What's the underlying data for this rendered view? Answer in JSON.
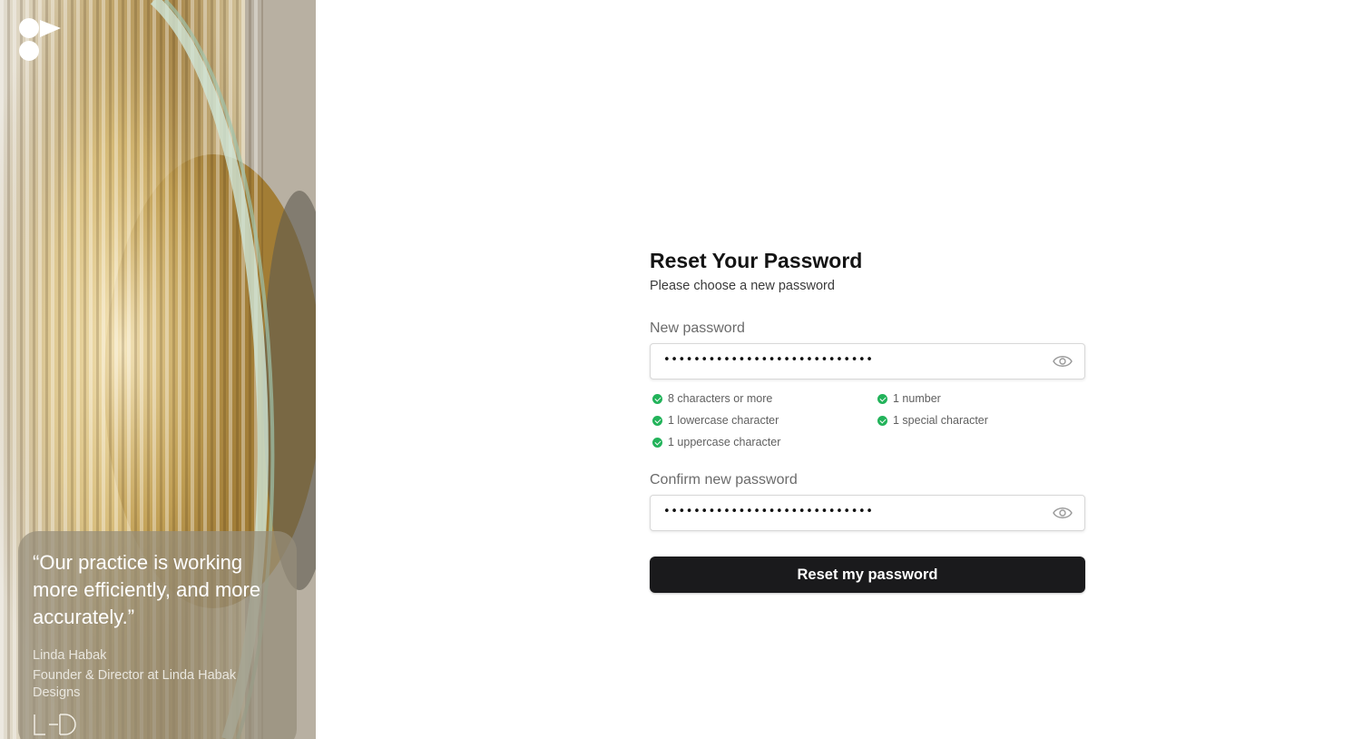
{
  "side_panel": {
    "quote": "“Our practice is working more efficiently, and more accurately.”",
    "author": "Linda Habak",
    "author_role": "Founder & Director at Linda Habak Designs",
    "company_logo_text": "LHD"
  },
  "form": {
    "title": "Reset Your Password",
    "subtitle": "Please choose a new password",
    "new_password": {
      "label": "New password",
      "masked_value": "••••••••••••••••••••••••••••"
    },
    "requirements": [
      {
        "text": "8 characters or more",
        "met": true
      },
      {
        "text": "1 number",
        "met": true
      },
      {
        "text": "1 lowercase character",
        "met": true
      },
      {
        "text": "1 special character",
        "met": true
      },
      {
        "text": "1 uppercase character",
        "met": true
      }
    ],
    "confirm_password": {
      "label": "Confirm new password",
      "masked_value": "••••••••••••••••••••••••••••"
    },
    "submit_label": "Reset my password"
  },
  "colors": {
    "button_bg": "#1a1a1c",
    "check_green": "#22b35a",
    "label_gray": "#6b6b6b"
  },
  "icons": [
    "brand-logo-icon",
    "eye-icon",
    "check-circle-icon"
  ]
}
